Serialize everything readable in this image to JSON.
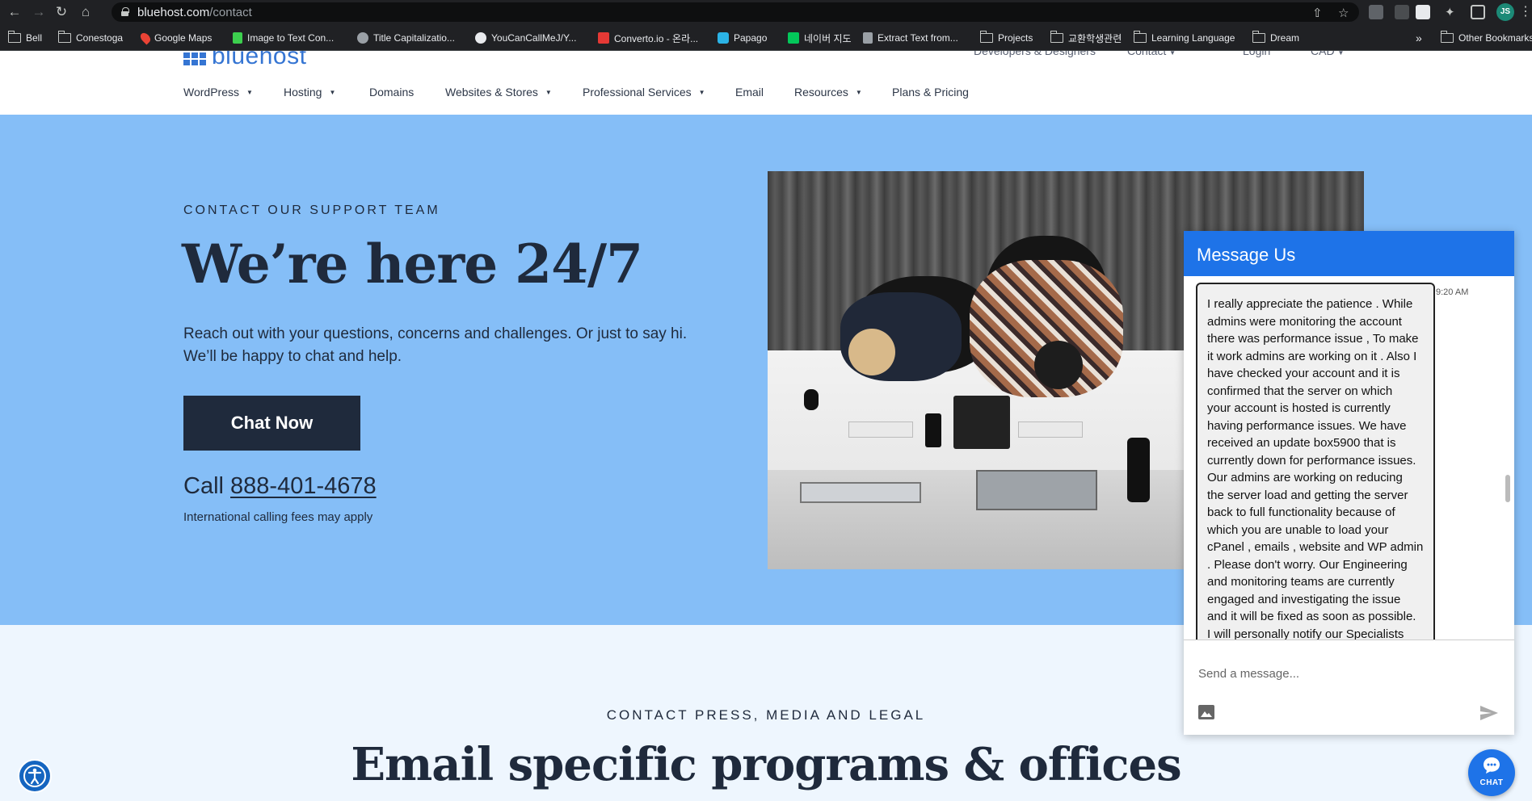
{
  "browser": {
    "url_host": "bluehost.com",
    "url_path": "/contact",
    "profile_initials": "JS",
    "bookmarks": [
      {
        "label": "Bell",
        "icon": "folder-icon"
      },
      {
        "label": "Conestoga",
        "icon": "folder-icon"
      },
      {
        "label": "Google Maps",
        "icon": "maps-icon"
      },
      {
        "label": "Image to Text Con...",
        "icon": "image-to-text-icon"
      },
      {
        "label": "Title Capitalizatio...",
        "icon": "title-cap-icon"
      },
      {
        "label": "YouCanCallMeJ/Y...",
        "icon": "github-icon"
      },
      {
        "label": "Converto.io - 온라...",
        "icon": "converto-icon"
      },
      {
        "label": "Papago",
        "icon": "papago-icon"
      },
      {
        "label": "네이버 지도",
        "icon": "naver-map-icon"
      },
      {
        "label": "Extract Text from...",
        "icon": "extract-text-icon"
      },
      {
        "label": "Projects",
        "icon": "folder-icon"
      },
      {
        "label": "교환학생관련",
        "icon": "folder-icon"
      },
      {
        "label": "Learning Language",
        "icon": "folder-icon"
      },
      {
        "label": "Dream",
        "icon": "folder-icon"
      }
    ],
    "overflow_label": "»",
    "other_bookmarks": "Other Bookmarks"
  },
  "site": {
    "logo_text": "bluehost",
    "top_links": [
      "Developers & Designers",
      "Contact",
      "Login",
      "CAD"
    ],
    "nav": [
      {
        "label": "WordPress",
        "dropdown": true
      },
      {
        "label": "Hosting",
        "dropdown": true
      },
      {
        "label": "Domains",
        "dropdown": false
      },
      {
        "label": "Websites & Stores",
        "dropdown": true
      },
      {
        "label": "Professional Services",
        "dropdown": true
      },
      {
        "label": "Email",
        "dropdown": false
      },
      {
        "label": "Resources",
        "dropdown": true
      },
      {
        "label": "Plans & Pricing",
        "dropdown": false
      }
    ]
  },
  "hero": {
    "eyebrow": "CONTACT OUR SUPPORT TEAM",
    "headline": "We’re here 24/7",
    "subcopy_line1": "Reach out with your questions, concerns and challenges. Or just to say hi.",
    "subcopy_line2": "We’ll be happy to chat and help.",
    "chat_button": "Chat Now",
    "call_prefix": "Call",
    "phone": "888-401-4678",
    "fee_note": "International calling fees may apply"
  },
  "lower": {
    "eyebrow": "CONTACT PRESS, MEDIA AND LEGAL",
    "title": "Email specific programs & offices"
  },
  "widget": {
    "title": "Message Us",
    "time": "9:20 AM",
    "message_lines": [
      "I really appreciate the patience . While",
      "admins were monitoring the account",
      "there was performance issue , To make",
      "it work admins are working on it . Also I",
      "have checked your account and it is",
      "confirmed that the server on which",
      "your account is hosted is currently",
      "having performance issues. We have",
      "received an update box5900  that is",
      "currently down for performance issues.",
      "Our admins are working on reducing",
      "the server load and getting the server",
      "back to full functionality because of",
      "which you are unable to load your",
      "cPanel , emails , website and WP admin",
      ". Please don't worry. Our Engineering",
      "and monitoring teams are currently",
      "engaged and investigating the issue",
      "and it will be fixed as soon as possible.",
      "I will personally notify our Specialists"
    ],
    "input_placeholder": "Send a message...",
    "fab_label": "CHAT",
    "accent": "#1e73e8"
  },
  "colors": {
    "hero_bg": "#85bef7",
    "navy": "#1f2a3c",
    "brand_blue": "#3575d3",
    "lower_bg": "#eef6fe"
  }
}
